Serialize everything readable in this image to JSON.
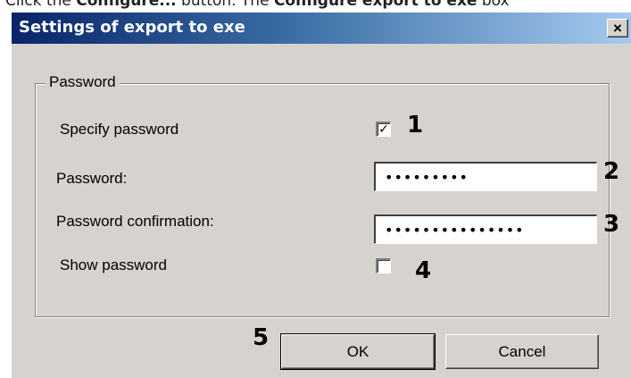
{
  "background": {
    "text_prefix": "Click the ",
    "text_bold1": "Configure...",
    "text_mid": " button. The ",
    "text_bold2": "Configure export to exe",
    "text_suffix": " box"
  },
  "dialog": {
    "title": "Settings of export to exe",
    "close_label": "×"
  },
  "group": {
    "title": "Password",
    "specify_password": {
      "label": "Specify password",
      "checked": true,
      "check_glyph": "✓"
    },
    "password": {
      "label": "Password:",
      "value": "•••••••••"
    },
    "confirmation": {
      "label": "Password confirmation:",
      "value": "•••••••••••••••"
    },
    "show_password": {
      "label": "Show password",
      "checked": false
    }
  },
  "callouts": [
    "1",
    "2",
    "3",
    "4",
    "5"
  ],
  "buttons": {
    "ok": "OK",
    "cancel": "Cancel"
  },
  "colors": {
    "title_gradient_start": "#0a246a",
    "title_gradient_end": "#a6caf0",
    "dialog_face": "#d6d3ce"
  }
}
